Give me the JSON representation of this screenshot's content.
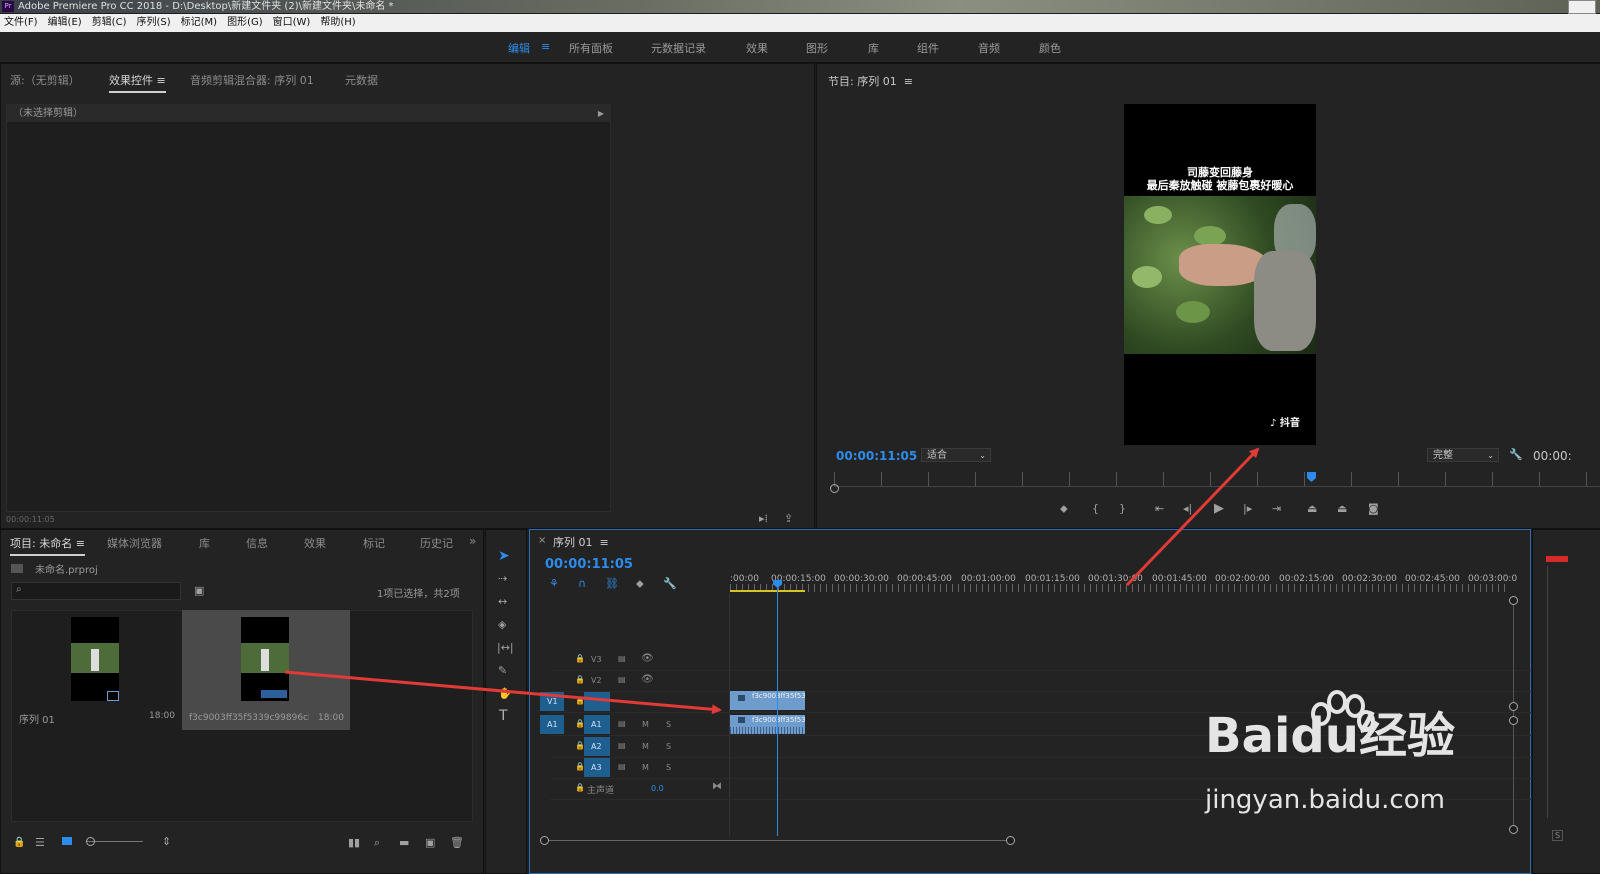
{
  "window": {
    "title": "Adobe Premiere Pro CC 2018 - D:\\Desktop\\新建文件夹 (2)\\新建文件夹\\未命名 *",
    "logo": "Pr"
  },
  "menu": [
    "文件(F)",
    "编辑(E)",
    "剪辑(C)",
    "序列(S)",
    "标记(M)",
    "图形(G)",
    "窗口(W)",
    "帮助(H)"
  ],
  "workspaces": {
    "active": "编辑",
    "items": [
      "所有面板",
      "元数据记录",
      "效果",
      "图形",
      "库",
      "组件",
      "音频",
      "颜色"
    ]
  },
  "source_panel": {
    "tabs": [
      "源:（无剪辑）",
      "效果控件",
      "音频剪辑混合器: 序列 01",
      "元数据"
    ],
    "no_clip": "（未选择剪辑）",
    "timecode": "00:00:11:05"
  },
  "program_monitor": {
    "title": "节目: 序列 01",
    "timecode": "00:00:11:05",
    "fit": "适合",
    "quality": "完整",
    "duration": "00:00:",
    "video_caption_line1": "司藤变回藤身",
    "video_caption_line2": "最后秦放触碰 被藤包裹好暖心",
    "watermark": "抖音"
  },
  "project_panel": {
    "tabs": [
      "项目: 未命名",
      "媒体浏览器",
      "库",
      "信息",
      "效果",
      "标记",
      "历史记"
    ],
    "file": "未命名.prproj",
    "selection": "1项已选择，共2项",
    "search_placeholder": "",
    "items": [
      {
        "name": "序列 01",
        "duration": "18:00"
      },
      {
        "name": "f3c9003ff35f5339c99896cbd...",
        "duration": "18:00"
      }
    ]
  },
  "timeline": {
    "tab": "序列 01",
    "timecode": "00:00:11:05",
    "ruler": [
      ":00:00",
      "00:00:15:00",
      "00:00:30:00",
      "00:00:45:00",
      "00:01:00:00",
      "00:01:15:00",
      "00:01:30:00",
      "00:01:45:00",
      "00:02:00:00",
      "00:02:15:00",
      "00:02:30:00",
      "00:02:45:00",
      "00:03:00:0"
    ],
    "tracks": {
      "video": [
        "V3",
        "V2",
        "V1"
      ],
      "audio": [
        "A1",
        "A2",
        "A3"
      ],
      "master": "主声道",
      "master_value": "0.0",
      "mute": "M",
      "solo": "S"
    },
    "clip_video": "f3c9003ff35f53",
    "clip_audio": "f3c9003ff35f53"
  },
  "watermark": {
    "brand": "Baidu经验",
    "url": "jingyan.baidu.com"
  },
  "colors": {
    "accent": "#2d8ceb",
    "clip": "#6e9ccd",
    "arrow": "#e23a36",
    "track_target": "#1e5f8f"
  }
}
